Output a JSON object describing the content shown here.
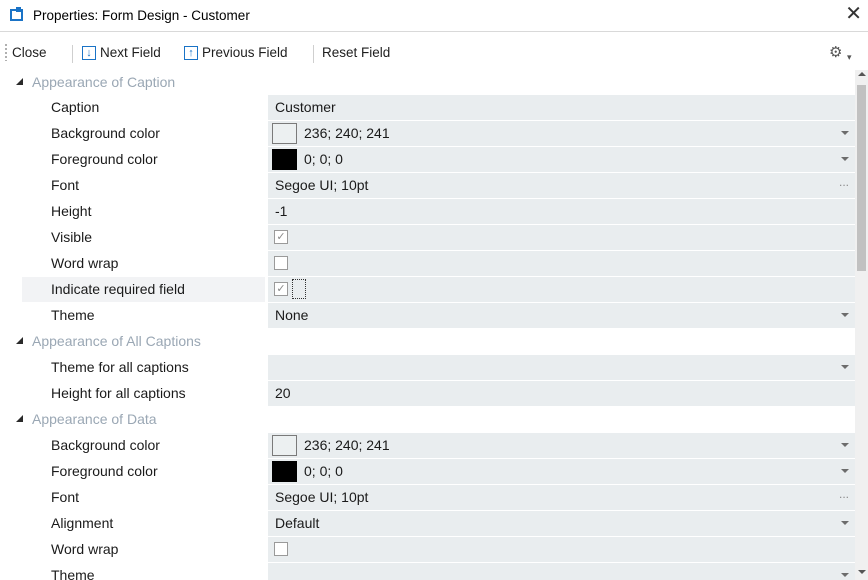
{
  "window": {
    "title": "Properties: Form Design - Customer",
    "close_glyph": "✕"
  },
  "toolbar": {
    "close_label": "Close",
    "next_label": "Next Field",
    "previous_label": "Previous Field",
    "reset_label": "Reset Field",
    "settings_icon": "gear-icon"
  },
  "caption_section": {
    "title": "Appearance of Caption",
    "caption": {
      "label": "Caption",
      "value": "Customer"
    },
    "background_color": {
      "label": "Background color",
      "value": "236; 240; 241",
      "swatch": "#ecf0f1"
    },
    "foreground_color": {
      "label": "Foreground color",
      "value": "0; 0; 0",
      "swatch": "#000000"
    },
    "font": {
      "label": "Font",
      "value": "Segoe UI; 10pt",
      "ellipsis": "..."
    },
    "height": {
      "label": "Height",
      "value": "-1"
    },
    "visible": {
      "label": "Visible",
      "checked": true
    },
    "word_wrap": {
      "label": "Word wrap",
      "checked": false
    },
    "indicate_required": {
      "label": "Indicate required field",
      "checked": true
    },
    "theme": {
      "label": "Theme",
      "value": "None"
    }
  },
  "all_captions_section": {
    "title": "Appearance of All Captions",
    "theme_all": {
      "label": "Theme for all captions",
      "value": ""
    },
    "height_all": {
      "label": "Height for all captions",
      "value": "20"
    }
  },
  "data_section": {
    "title": "Appearance of Data",
    "background_color": {
      "label": "Background color",
      "value": "236; 240; 241",
      "swatch": "#ecf0f1"
    },
    "foreground_color": {
      "label": "Foreground color",
      "value": "0; 0; 0",
      "swatch": "#000000"
    },
    "font": {
      "label": "Font",
      "value": "Segoe UI; 10pt",
      "ellipsis": "..."
    },
    "alignment": {
      "label": "Alignment",
      "value": "Default"
    },
    "word_wrap": {
      "label": "Word wrap",
      "checked": false
    },
    "theme": {
      "label": "Theme",
      "value": ""
    }
  },
  "glyphs": {
    "check": "✓",
    "next_arrow": "↓",
    "prev_arrow": "↑",
    "gear": "⚙",
    "drop": "▾"
  }
}
